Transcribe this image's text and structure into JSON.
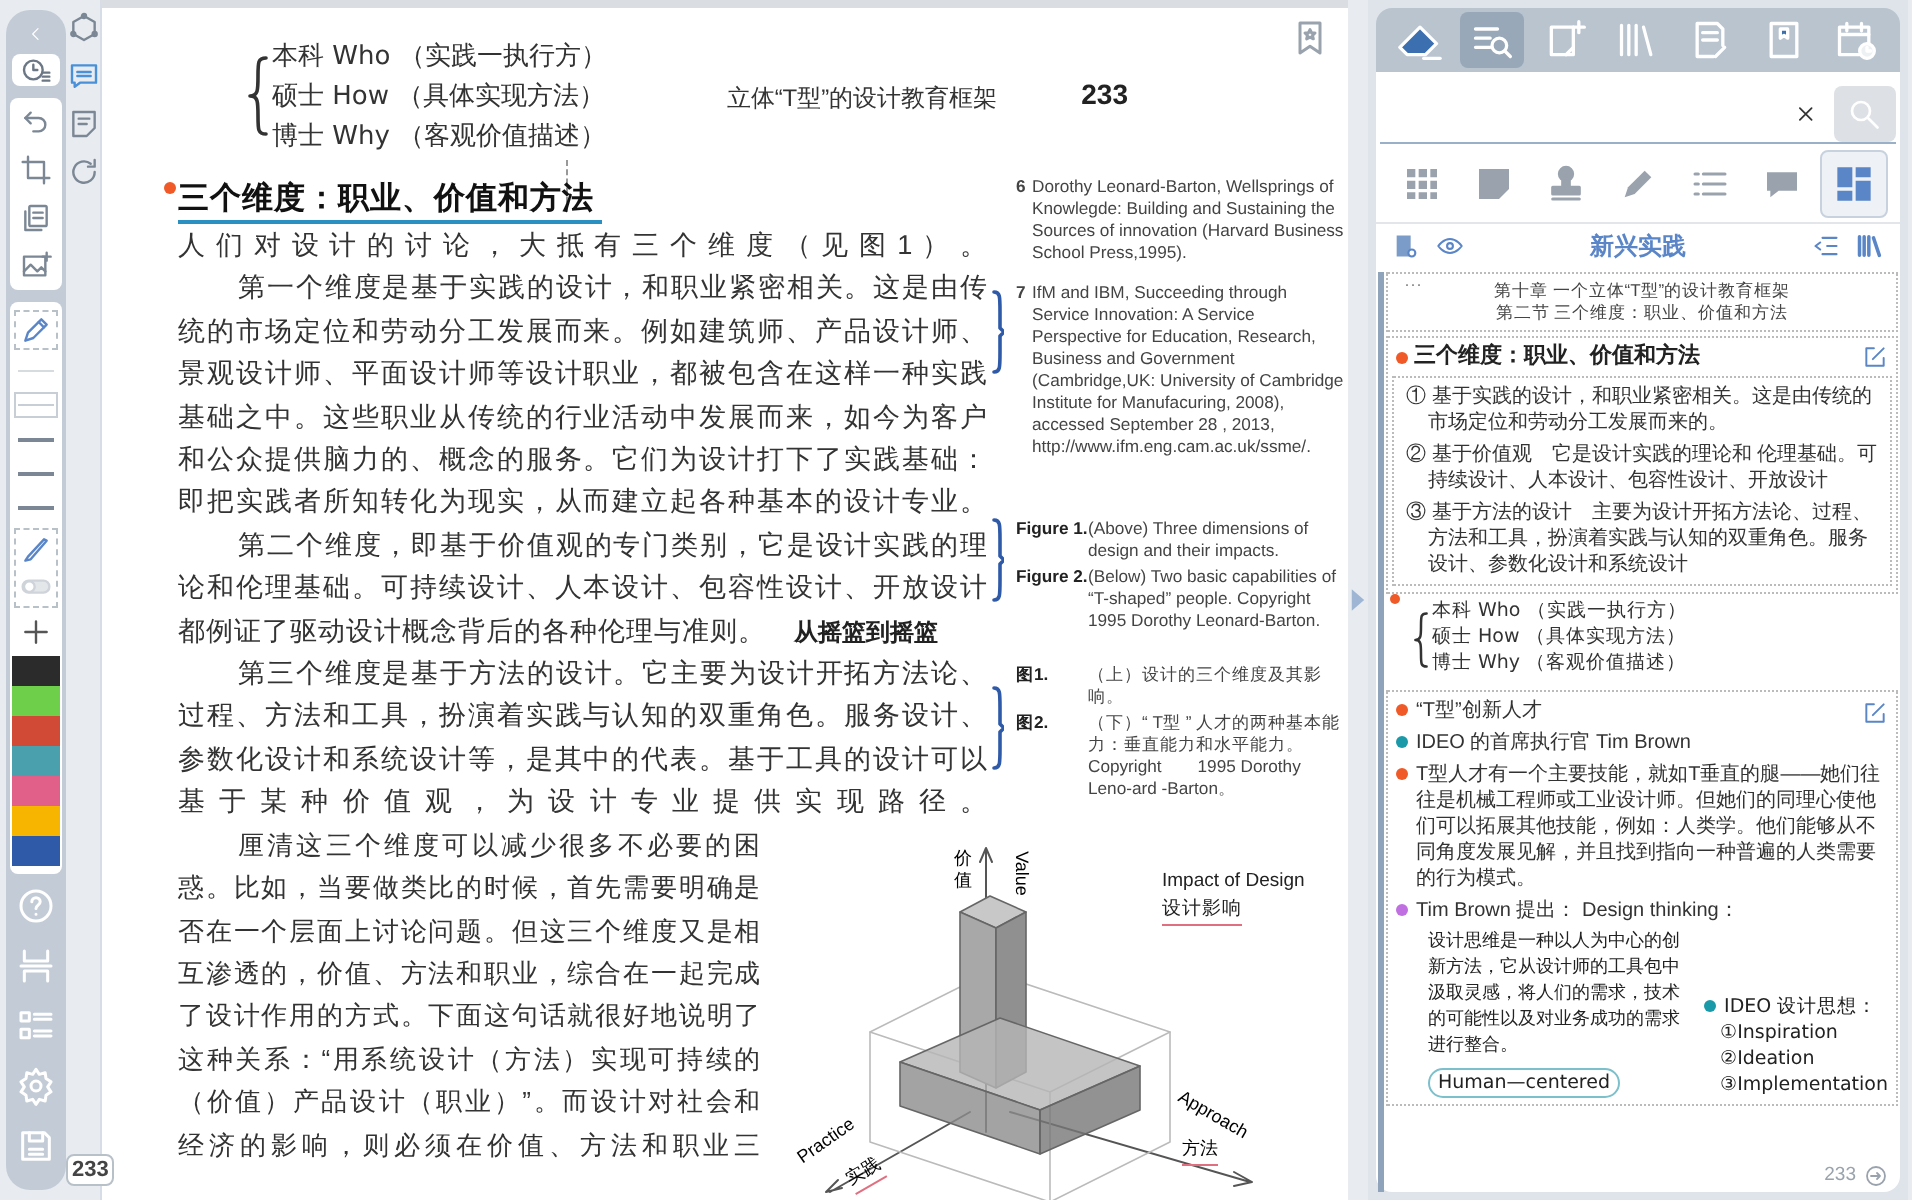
{
  "toolbar": {
    "line_widths": [
      {
        "selected": false
      },
      {
        "selected": true
      },
      {
        "selected": false
      },
      {
        "selected": false
      },
      {
        "selected": false
      }
    ],
    "colors": [
      {
        "color": "#2b2b2b"
      },
      {
        "color": "#6ecf4a"
      },
      {
        "color": "#d04a35"
      },
      {
        "color": "#4aa0ad"
      },
      {
        "color": "#e0608a"
      },
      {
        "color": "#f7b500"
      },
      {
        "color": "#2f5aa8"
      }
    ]
  },
  "side_tools": [
    {
      "selected": false
    },
    {
      "selected": true
    },
    {
      "selected": false
    },
    {
      "selected": false
    }
  ],
  "page": {
    "handwritten_lines": [
      "本科 Who （实践一执行方）",
      "硕士 How （具体实现方法）",
      "博士 Why （客观价值描述）"
    ],
    "running_head": "立体“T型”的设计教育框架",
    "page_number": "233",
    "heading": "三个维度：职业、价值和方法",
    "paragraphs": [
      {
        "indented": false,
        "text": "人们对设计的讨论，大抵有三个维度（见图1）。"
      },
      {
        "indented": true,
        "text": "第一个维度是基于实践的设计，和职业紧密相关。这是由传统的市场定位和劳动分工发展而来。例如建筑师、产品设计师、景观设计师、平面设计师等设计职业，都被包含在这样一种实践基础之中。这些职业从传统的行业活动中发展而来，如今为客户和公众提供脑力的、概念的服务。它们为设计打下了实践基础：即把实践者所知转化为现实，从而建立起各种基本的设计专业。"
      },
      {
        "indented": true,
        "text": "第二个维度，即基于价值观的专门类别，它是设计实践的理论和伦理基础。可持续设计、人本设计、包容性设计、开放设计",
        "last_line": "都例证了驱动设计概念背后的各种伦理与准则。",
        "aside": "从摇篮到摇篮"
      },
      {
        "indented": true,
        "text": "第三个维度是基于方法的设计。它主要为设计开拓方法论、过程、方法和工具，扮演着实践与认知的双重角色。服务设计、参数化设计和系统设计等，是其中的代表。基于工具的设计可以基于某种价值观，为设计专业提供实现路径。"
      },
      {
        "indented": true,
        "narrow": true,
        "text": "厘清这三个维度可以减少很多不必要的困惑。比如，当要做类比的时候，首先需要明确是否在一个层面上讨论问题。但这三个维度又是相互渗透的，价值、方法和职业，综合在一起完成了设计作用的方式。下面这句话就很好地说明了这种关系：“用系统设计（方法）实现可持续的（价值）产品设计（职业）”。而设计对社会和经济的影响，则必须在价值、方法和职业三"
      }
    ],
    "footnotes": [
      {
        "number": "6",
        "text": "Dorothy Leonard-Barton, Wellsprings of Knowlegde: Building and Sustaining the Sources of  innovation (Harvard Business School Press,1995)."
      },
      {
        "number": "7",
        "text": "IfM and IBM, Succeeding through Service Innovation: A Service Perspective for Education, Research, Business and Government (Cambridge,UK: University of Cambridge Institute for Manufacuring, 2008), accessed September 28 , 2013, http://www.ifm.eng.cam.ac.uk/ssme/."
      }
    ],
    "captions_en": [
      {
        "label": "Figure 1.",
        "text": "(Above) Three dimensions of design and their impacts."
      },
      {
        "label": "Figure 2.",
        "text": "(Below) Two basic capabilities of “T-shaped” people. Copyright 1995 Dorothy Leonard-Barton."
      }
    ],
    "captions_zh": [
      {
        "label": "图1.",
        "text": "（上）设计的三个维度及其影响。"
      },
      {
        "label": "图2.",
        "text": "（下）“ T型 ” 人才的两种基本能力：垂直能力和水平能力。Copyright　　1995 Dorothy Leno-ard -Barton。"
      }
    ],
    "figure_labels": {
      "value_zh": "价值",
      "value": "Value",
      "impact": "Impact of Design",
      "impact_zh": "设计影响",
      "practice": "Practice",
      "practice_zh": "实践",
      "approach": "Approach",
      "approach_zh": "方法"
    },
    "page_badge": "233"
  },
  "panel": {
    "tools": [
      {
        "selected": false
      },
      {
        "selected": true
      },
      {
        "selected": false
      },
      {
        "selected": false
      },
      {
        "selected": false
      },
      {
        "selected": false
      },
      {
        "selected": false
      }
    ],
    "filters": [
      {
        "selected": false
      },
      {
        "selected": false
      },
      {
        "selected": false
      },
      {
        "selected": false
      },
      {
        "selected": false
      },
      {
        "selected": false
      },
      {
        "selected": true
      }
    ],
    "title": "新兴实践",
    "chapter": {
      "more": "···",
      "lines": [
        "第十章  一个立体“T型”的设计教育框架",
        "第二节 三个维度：职业、价值和方法"
      ]
    },
    "excerpt": {
      "color": "#f05a28",
      "title": "三个维度：职业、价值和方法",
      "items": [
        "① 基于实践的设计，和职业紧密相关。这是由传统的市场定位和劳动分工发展而来的。",
        "② 基于价值观　它是设计实践的理论和 伦理基础。可持续设计、人本设计、包容性设计、开放设计",
        "③ 基于方法的设计　主要为设计开拓方法论、过程、方法和工具，扮演着实践与认知的双重角色。服务设计、参数化设计和系统设计"
      ]
    },
    "handwriting": {
      "color": "#f05a28",
      "lines": [
        "本科 Who （实践一执行方）",
        "硕士 How （具体实现方法）",
        "博士 Why （客观价值描述）"
      ]
    },
    "notes": [
      {
        "kind": "text",
        "color": "#f05a28",
        "text": "“T型”创新人才"
      },
      {
        "kind": "text",
        "color": "#1a9aa8",
        "text": "IDEO 的首席执行官 Tim Brown"
      },
      {
        "kind": "text",
        "color": "#f05a28",
        "text": "T型人才有一个主要技能，就如T垂直的腿——她们往往是机械工程师或工业设计师。但她们的同理心使他们可以拓展其他技能，例如：人类学。他们能够从不同角度发展见解，并且找到指向一种普遍的人类需要的行为模式。"
      },
      {
        "kind": "text",
        "color": "#c070e0",
        "text": "Tim Brown 提出： Design thinking："
      },
      {
        "kind": "script",
        "text": "设计思维是一种以人为中心的创新方法，它从设计师的工具包中汲取灵感，将人们的需求，技术的可能性以及对业务成功的需求进行整合。"
      },
      {
        "kind": "tag",
        "text": "Human—centered"
      },
      {
        "kind": "list",
        "color": "#1a9aa8",
        "title": "IDEO 设计思想：",
        "items": [
          "①Inspiration",
          "②Ideation",
          "③Implementation"
        ]
      }
    ],
    "footer_page": "233"
  }
}
